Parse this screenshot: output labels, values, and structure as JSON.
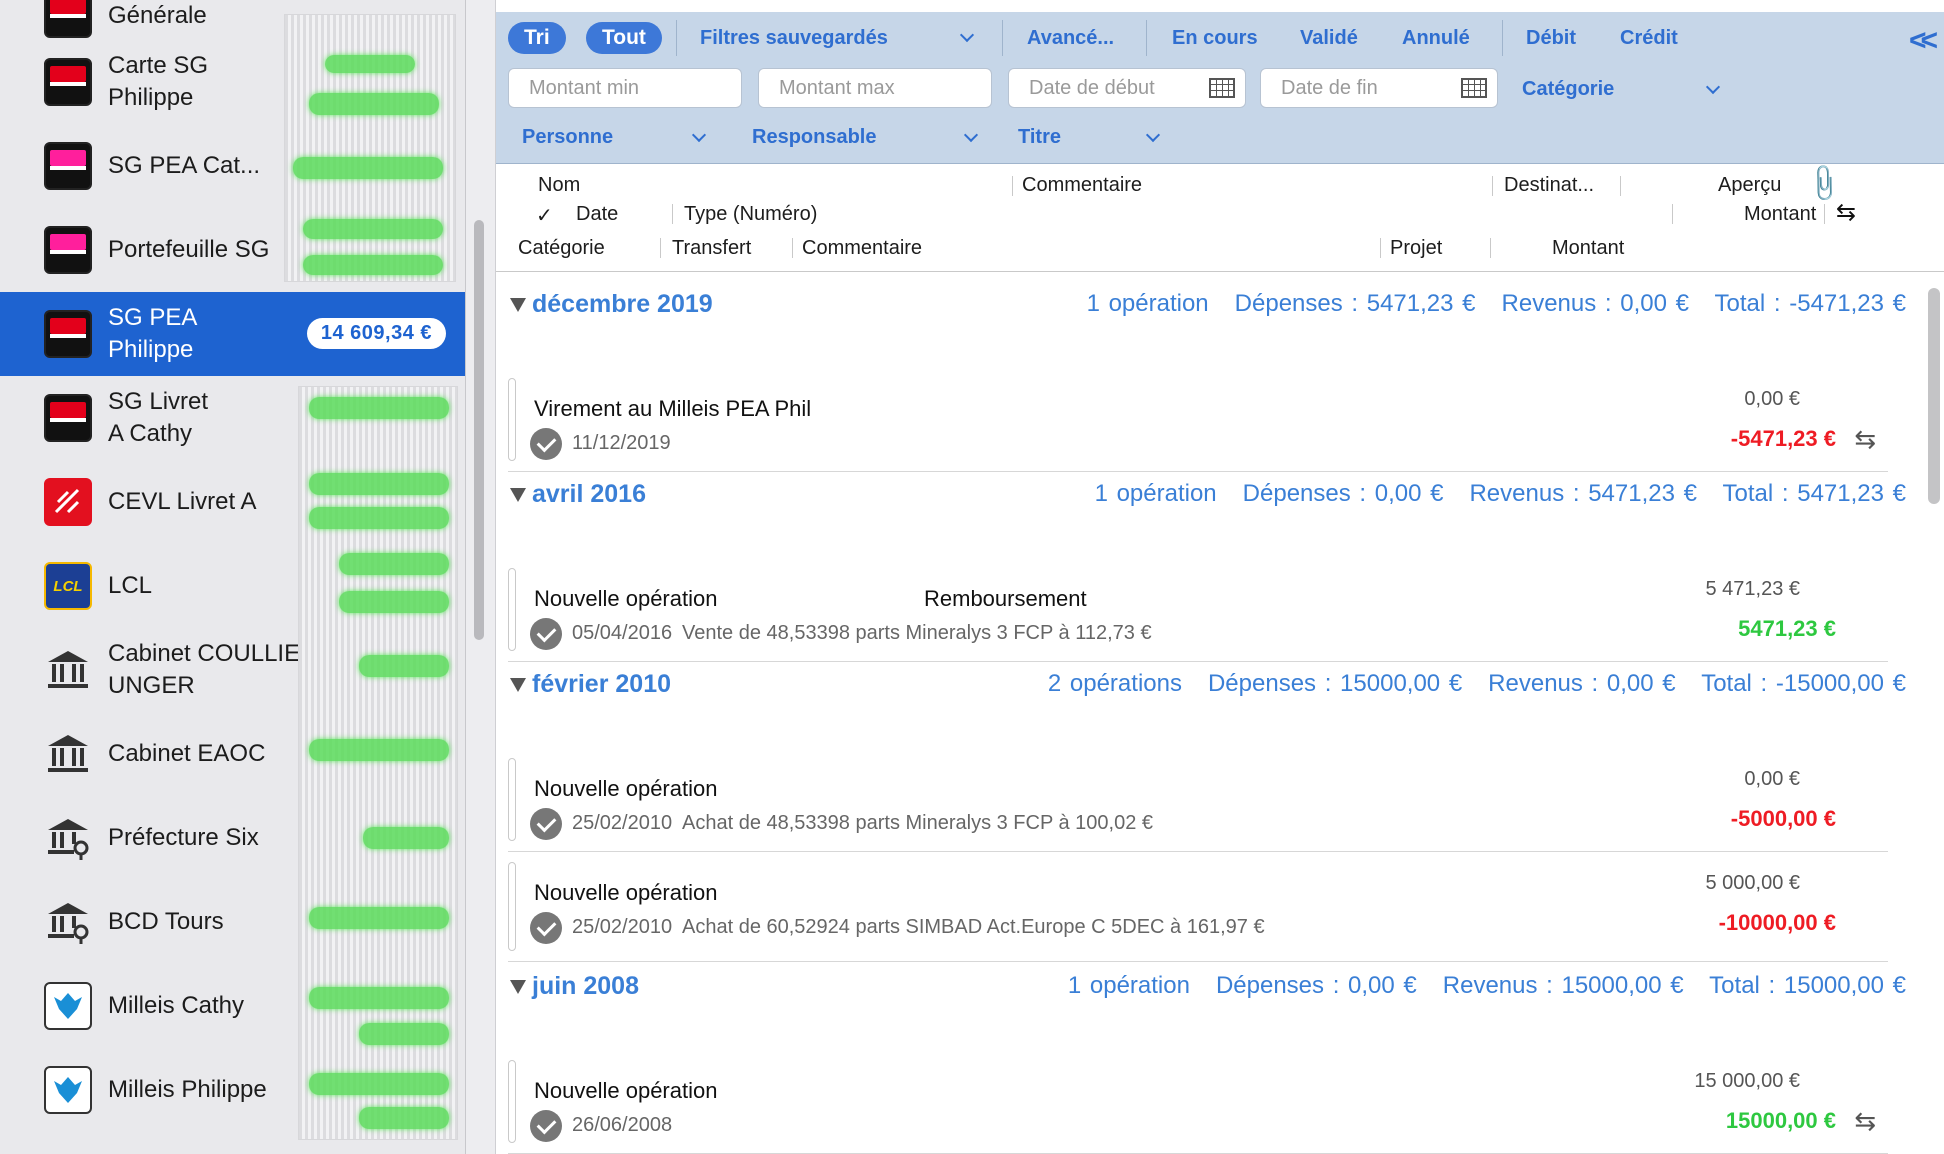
{
  "sidebar": {
    "accounts": [
      {
        "name": "Générale",
        "icon": "sg-bank-icon"
      },
      {
        "name": "Carte SG\nPhilippe",
        "icon": "sg-bank-icon"
      },
      {
        "name": "SG PEA Cat...",
        "icon": "sg-pink-bank-icon"
      },
      {
        "name": "Portefeuille SG",
        "icon": "sg-pink-bank-icon"
      },
      {
        "name": "SG PEA\nPhilippe",
        "icon": "sg-bank-icon",
        "selected": true,
        "balance": "14 609,34 €"
      },
      {
        "name": "SG Livret\nA Cathy",
        "icon": "sg-bank-icon"
      },
      {
        "name": "CEVL Livret A",
        "icon": "caisse-epargne-icon"
      },
      {
        "name": "LCL",
        "icon": "lcl-icon"
      },
      {
        "name": "Cabinet COULLIEN\nUNGER",
        "icon": "bank-building-icon"
      },
      {
        "name": "Cabinet EAOC",
        "icon": "bank-building-icon"
      },
      {
        "name": "Préfecture Six",
        "icon": "bank-key-icon"
      },
      {
        "name": "BCD Tours",
        "icon": "bank-key-icon"
      },
      {
        "name": "Milleis Cathy",
        "icon": "milleis-eagle-icon"
      },
      {
        "name": "Milleis Philippe",
        "icon": "milleis-eagle-icon"
      }
    ]
  },
  "filters": {
    "sort": "Tri",
    "all": "Tout",
    "saved_filters": "Filtres sauvegardés",
    "advanced": "Avancé...",
    "pending": "En cours",
    "validated": "Validé",
    "cancelled": "Annulé",
    "debit": "Débit",
    "credit": "Crédit",
    "amount_min": "Montant min",
    "amount_max": "Montant max",
    "date_start": "Date de début",
    "date_end": "Date de fin",
    "category": "Catégorie",
    "person": "Personne",
    "responsible": "Responsable",
    "title": "Titre"
  },
  "columns": {
    "row1": {
      "name": "Nom",
      "comment": "Commentaire",
      "dest": "Destinat...",
      "preview": "Aperçu"
    },
    "row2": {
      "check": "✓",
      "date": "Date",
      "type": "Type (Numéro)",
      "amount": "Montant"
    },
    "row3": {
      "category": "Catégorie",
      "transfer": "Transfert",
      "comment": "Commentaire",
      "project": "Projet",
      "amount": "Montant"
    }
  },
  "groups": [
    {
      "month": "décembre 2019",
      "summary": "1 opération   Dépenses : 5471,23 €   Revenus : 0,00 €   Total : -5471,23 €"
    },
    {
      "month": "avril 2016",
      "summary": "1 opération   Dépenses : 0,00 €   Revenus : 5471,23 €   Total : 5471,23 €"
    },
    {
      "month": "février 2010",
      "summary": "2 opérations   Dépenses : 15000,00 €   Revenus : 0,00 €   Total : -15000,00 €"
    },
    {
      "month": "juin 2008",
      "summary": "1 opération   Dépenses : 0,00 €   Revenus : 15000,00 €   Total : 15000,00 €"
    }
  ],
  "rows": [
    {
      "name": "Virement au Milleis PEA Phil",
      "dest": "",
      "date": "11/12/2019",
      "comment": "",
      "balance": "0,00 €",
      "amount": "-5471,23 €",
      "sign": "neg",
      "transfer": true
    },
    {
      "name": "Nouvelle opération",
      "dest": "Remboursement",
      "date": "05/04/2016",
      "comment": "Vente de 48,53398 parts Mineralys 3 FCP à 112,73 €",
      "balance": "5 471,23 €",
      "amount": "5471,23 €",
      "sign": "pos",
      "transfer": false
    },
    {
      "name": "Nouvelle opération",
      "dest": "",
      "date": "25/02/2010",
      "comment": "Achat de 48,53398 parts Mineralys 3 FCP à 100,02 €",
      "balance": "0,00 €",
      "amount": "-5000,00 €",
      "sign": "neg",
      "transfer": false
    },
    {
      "name": "Nouvelle opération",
      "dest": "",
      "date": "25/02/2010",
      "comment": "Achat de 60,52924 parts SIMBAD Act.Europe C 5DEC à 161,97 €",
      "balance": "5 000,00 €",
      "amount": "-10000,00 €",
      "sign": "neg",
      "transfer": false
    },
    {
      "name": "Nouvelle opération",
      "dest": "",
      "date": "26/06/2008",
      "comment": "",
      "balance": "15 000,00 €",
      "amount": "15000,00 €",
      "sign": "pos",
      "transfer": true
    }
  ]
}
